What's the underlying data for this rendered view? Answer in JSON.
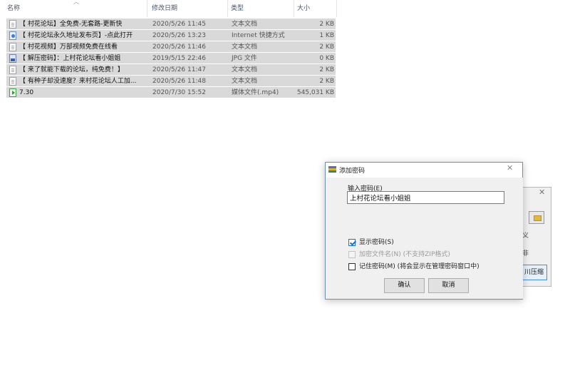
{
  "file_list": {
    "headers": {
      "name": "名称",
      "date": "修改日期",
      "type": "类型",
      "size": "大小"
    },
    "rows": [
      {
        "icon": "text-doc-icon",
        "name": "【 村花论坛】全免费-无套路-更新快",
        "date": "2020/5/26 11:45",
        "type": "文本文档",
        "size": "2 KB"
      },
      {
        "icon": "internet-shortcut-icon",
        "name": "【 村花论坛永久地址发布页】-点此打开",
        "date": "2020/5/26 13:23",
        "type": "Internet 快捷方式",
        "size": "1 KB"
      },
      {
        "icon": "text-doc-icon",
        "name": "【 村花视频】万部视频免费在线看",
        "date": "2020/5/26 11:46",
        "type": "文本文档",
        "size": "2 KB"
      },
      {
        "icon": "jpg-file-icon",
        "name": "【 解压密码】：上村花论坛看小姐姐",
        "date": "2019/5/15 22:46",
        "type": "JPG 文件",
        "size": "0 KB"
      },
      {
        "icon": "text-doc-icon",
        "name": "【 来了就能下载的论坛，纯免费！】",
        "date": "2020/5/26 11:47",
        "type": "文本文档",
        "size": "2 KB"
      },
      {
        "icon": "text-doc-icon",
        "name": "【 有种子却没速度？来村花论坛人工加...",
        "date": "2020/5/26 11:48",
        "type": "文本文档",
        "size": "2 KB"
      },
      {
        "icon": "video-file-icon",
        "name": "7.30",
        "date": "2020/7/30 15:52",
        "type": "媒体文件(.mp4)",
        "size": "545,031 KB"
      }
    ]
  },
  "bg_dialog": {
    "text1": "义",
    "text2": "非",
    "button_label": "川压缩"
  },
  "dialog": {
    "title": "添加密码",
    "close": "✕",
    "password_label": "输入密码(E)",
    "password_value": "上村花论坛看小姐姐",
    "show_password": {
      "label": "显示密码(S)",
      "checked": true
    },
    "encrypt_names": {
      "label": "加密文件名(N) (不支持ZIP格式)",
      "checked": false,
      "disabled": true
    },
    "remember_password": {
      "label": "记住密码(M) (将会显示在管理密码窗口中)",
      "checked": false
    },
    "ok_label": "确认",
    "cancel_label": "取消"
  }
}
